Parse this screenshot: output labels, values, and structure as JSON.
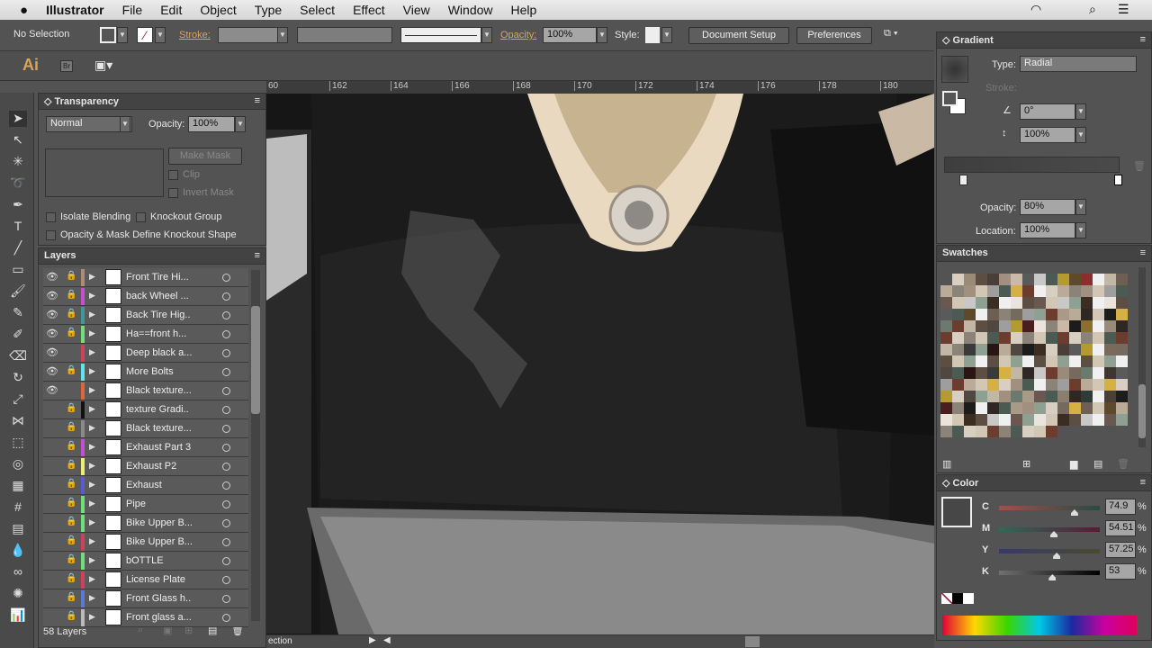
{
  "menubar": {
    "app": "Illustrator",
    "items": [
      "File",
      "Edit",
      "Object",
      "Type",
      "Select",
      "Effect",
      "View",
      "Window",
      "Help"
    ]
  },
  "control": {
    "selection": "No Selection",
    "stroke_label": "Stroke:",
    "opacity_label": "Opacity:",
    "opacity_value": "100%",
    "style_label": "Style:",
    "document_setup": "Document Setup",
    "preferences": "Preferences"
  },
  "appbar": {
    "logo": "Ai",
    "bridge": "Br"
  },
  "ruler": {
    "ticks": [
      "60",
      "162",
      "164",
      "166",
      "168",
      "170",
      "172",
      "174",
      "176",
      "178",
      "180"
    ]
  },
  "transparency": {
    "title": "Transparency",
    "blend_mode": "Normal",
    "opacity_label": "Opacity:",
    "opacity_value": "100%",
    "make_mask": "Make Mask",
    "clip": "Clip",
    "invert_mask": "Invert Mask",
    "isolate_blending": "Isolate Blending",
    "knockout_group": "Knockout Group",
    "opacity_mask_knockout": "Opacity & Mask Define Knockout Shape"
  },
  "layers": {
    "title": "Layers",
    "count": "58 Layers",
    "rows": [
      {
        "name": "Front Tire Hi...",
        "color": "#b08a74",
        "visible": true,
        "locked": true
      },
      {
        "name": "back Wheel ...",
        "color": "#c44fd0",
        "visible": true,
        "locked": true
      },
      {
        "name": "Back Tire Hig..",
        "color": "#3c9a9a",
        "visible": true,
        "locked": true
      },
      {
        "name": "Ha==front h...",
        "color": "#6ee07a",
        "visible": true,
        "locked": true
      },
      {
        "name": "Deep black a...",
        "color": "#d0405a",
        "visible": true,
        "locked": false
      },
      {
        "name": "More Bolts",
        "color": "#5fe6ea",
        "visible": true,
        "locked": true
      },
      {
        "name": "Black texture...",
        "color": "#e0653a",
        "visible": true,
        "locked": false
      },
      {
        "name": "texture Gradi..",
        "color": "#111111",
        "visible": false,
        "locked": true
      },
      {
        "name": "Black texture...",
        "color": "#8a8a8a",
        "visible": false,
        "locked": true
      },
      {
        "name": "Exhaust Part 3",
        "color": "#c44fd0",
        "visible": false,
        "locked": true
      },
      {
        "name": "Exhaust P2",
        "color": "#eeee70",
        "visible": false,
        "locked": true
      },
      {
        "name": "Exhaust",
        "color": "#5a5ad6",
        "visible": false,
        "locked": true
      },
      {
        "name": "Pipe",
        "color": "#6ee07a",
        "visible": false,
        "locked": true
      },
      {
        "name": "Bike Upper B...",
        "color": "#6ee07a",
        "visible": false,
        "locked": true
      },
      {
        "name": "Bike Upper B...",
        "color": "#d0405a",
        "visible": false,
        "locked": true
      },
      {
        "name": "bOTTLE",
        "color": "#6ee07a",
        "visible": false,
        "locked": true
      },
      {
        "name": "License Plate",
        "color": "#d0405a",
        "visible": false,
        "locked": true
      },
      {
        "name": "Front Glass h..",
        "color": "#5a7ad6",
        "visible": false,
        "locked": true
      },
      {
        "name": "Front glass a...",
        "color": "#bbbbbb",
        "visible": false,
        "locked": true
      }
    ]
  },
  "gradient": {
    "title": "Gradient",
    "type_label": "Type:",
    "type_value": "Radial",
    "stroke_label": "Stroke:",
    "angle_value": "0°",
    "aspect_value": "100%",
    "opacity_label": "Opacity:",
    "opacity_value": "80%",
    "location_label": "Location:",
    "location_value": "100%"
  },
  "swatches": {
    "title": "Swatches",
    "colors": [
      "#8c7e6e",
      "#a89a86",
      "#c2b6a4",
      "#d8cfc2",
      "#eae4dc",
      "#6d5f52",
      "#9a8b78",
      "#b9ab98",
      "#7a6a5c",
      "#5c4e43",
      "#3f3630",
      "#8b8378",
      "#4a3f38",
      "#2e2724",
      "#6a5850",
      "#a18f80",
      "#504840",
      "#76695e",
      "#c9b9a5",
      "#d2c6b5",
      "#3a3a3a",
      "#5a5a5a",
      "#7d7d7d",
      "#9e9e9e",
      "#c8c8c8",
      "#1c1c1c",
      "#2d3b39",
      "#4c5a54",
      "#6b7a6f",
      "#8ea092",
      "#b59b2f",
      "#d4b045",
      "#8a6f2e",
      "#5e4a2a",
      "#3b2d22",
      "#6c3d2e",
      "#8c2e2e",
      "#4a1e1e",
      "#2b1414",
      "#f0f0f0"
    ],
    "progress": true
  },
  "color": {
    "title": "Color",
    "channels": [
      {
        "label": "C",
        "value": "74.9",
        "fraction": 0.749,
        "from": "#a0504a",
        "to": "#2a4a44"
      },
      {
        "label": "M",
        "value": "54.51",
        "fraction": 0.545,
        "from": "#2e6a58",
        "to": "#5a1a34"
      },
      {
        "label": "Y",
        "value": "57.25",
        "fraction": 0.5725,
        "from": "#363a6a",
        "to": "#4a4a30"
      },
      {
        "label": "K",
        "value": "53",
        "fraction": 0.53,
        "from": "#707070",
        "to": "#000000"
      }
    ],
    "percent": "%",
    "fill": "#474747"
  },
  "status": {
    "text": "ection"
  }
}
